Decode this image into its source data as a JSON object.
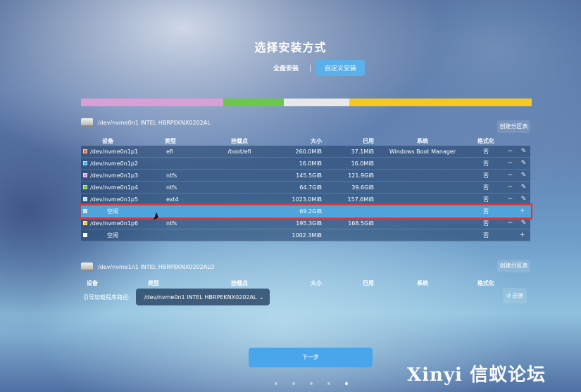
{
  "title": "选择安装方式",
  "mode_tabs": [
    {
      "label": "全盘安装",
      "active": false
    },
    {
      "label": "自定义安装",
      "active": true
    }
  ],
  "usage_bar": [
    {
      "color": "#d9a0d8",
      "fraction": 0.315
    },
    {
      "color": "#6bc84a",
      "fraction": 0.135
    },
    {
      "color": "#e8e8e8",
      "fraction": 0.145
    },
    {
      "color": "#f5c822",
      "fraction": 0.405
    }
  ],
  "disk1": {
    "name": "/dev/nvme0n1 INTEL HBRPEKNX0202AL",
    "create_label": "创建分区表",
    "headers": [
      "设备",
      "类型",
      "挂载点",
      "大小",
      "已用",
      "系统",
      "格式化"
    ],
    "rows": [
      {
        "device": "/dev/nvme0n1p1",
        "color": "#e07a3a",
        "type": "efi",
        "mount": "/boot/efi",
        "size": "260.0MiB",
        "used": "37.1MiB",
        "system": "Windows Boot Manager",
        "format": "否",
        "action": "remove"
      },
      {
        "device": "/dev/nvme0n1p2",
        "color": "#4bb0e6",
        "type": "",
        "mount": "",
        "size": "16.0MiB",
        "used": "16.0MiB",
        "system": "",
        "format": "否",
        "action": "remove"
      },
      {
        "device": "/dev/nvme0n1p3",
        "color": "#d89ad6",
        "type": "ntfs",
        "mount": "",
        "size": "145.5GiB",
        "used": "121.9GiB",
        "system": "",
        "format": "否",
        "action": "remove"
      },
      {
        "device": "/dev/nvme0n1p4",
        "color": "#6bc84a",
        "type": "ntfs",
        "mount": "",
        "size": "64.7GiB",
        "used": "39.6GiB",
        "system": "",
        "format": "否",
        "action": "remove"
      },
      {
        "device": "/dev/nvme0n1p5",
        "color": "#b8dceb",
        "type": "ext4",
        "mount": "",
        "size": "1023.0MiB",
        "used": "157.6MiB",
        "system": "",
        "format": "否",
        "action": "remove"
      },
      {
        "device": "空闲",
        "color": "#c7d7e6",
        "type": "",
        "mount": "",
        "size": "69.2GiB",
        "used": "",
        "system": "",
        "format": "否",
        "action": "add",
        "selected": true
      },
      {
        "device": "/dev/nvme0n1p6",
        "color": "#f5c822",
        "type": "ntfs",
        "mount": "",
        "size": "195.3GiB",
        "used": "168.5GiB",
        "system": "",
        "format": "否",
        "action": "remove"
      },
      {
        "device": "空闲",
        "color": "#ffffff",
        "type": "",
        "mount": "",
        "size": "1002.3MiB",
        "used": "",
        "system": "",
        "format": "否",
        "action": "add"
      }
    ]
  },
  "disk2": {
    "name": "/dev/nvme1n1 INTEL HBRPEKNX0202ALO",
    "create_label": "创建分区表",
    "headers": [
      "设备",
      "类型",
      "挂载点",
      "大小",
      "已用",
      "系统",
      "格式化"
    ]
  },
  "bootloader": {
    "label": "引导加载程序路径:",
    "value": "/dev/nvme0n1 INTEL HBRPEKNX0202AL"
  },
  "restore_label": "还原",
  "next_label": "下一步",
  "page_dots": 5,
  "active_dot": 4,
  "watermark": "Xinyi 信蚁论坛"
}
